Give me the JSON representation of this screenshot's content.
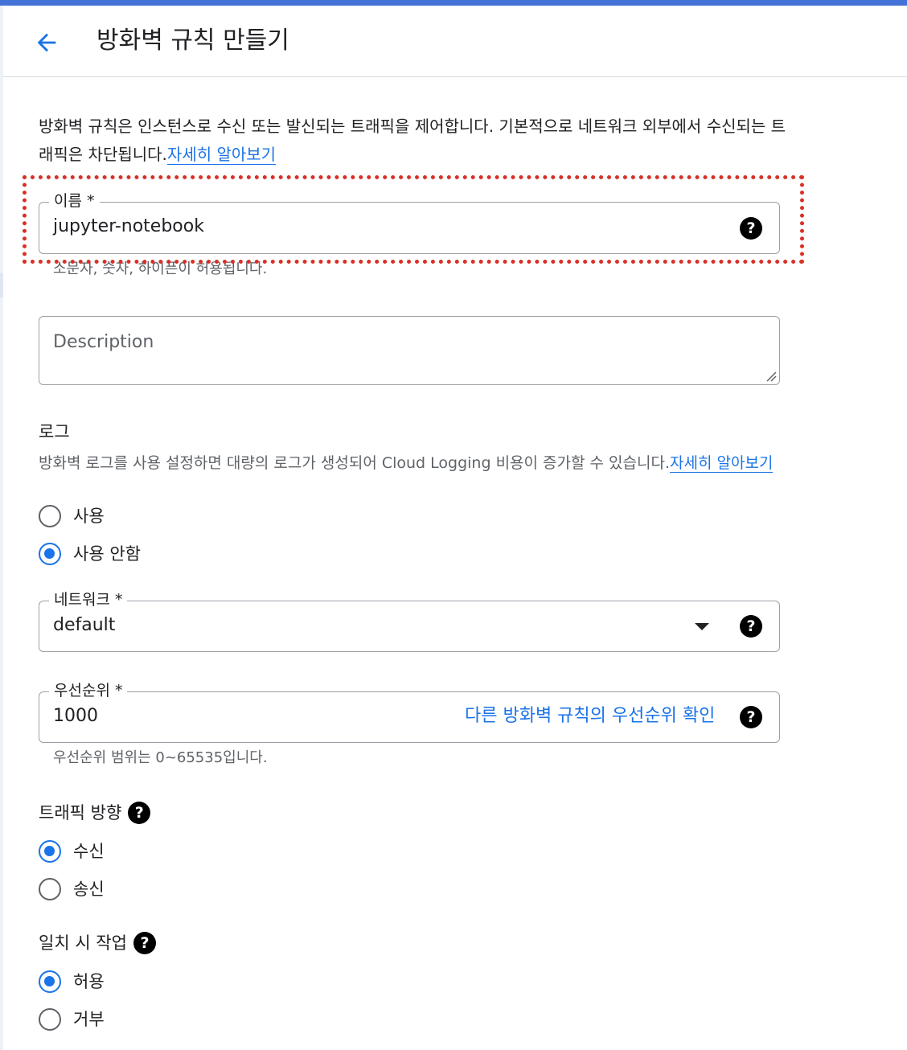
{
  "header": {
    "title": "방화벽 규칙 만들기",
    "back_icon": "arrow-back-icon"
  },
  "intro": {
    "text": "방화벽 규칙은 인스턴스로 수신 또는 발신되는 트래픽을 제어합니다. 기본적으로 네트워크 외부에서 수신되는 트래픽은 차단됩니다.",
    "link": "자세히 알아보기"
  },
  "name_field": {
    "label": "이름 *",
    "value": "jupyter-notebook",
    "hint": "소문자, 숫자, 하이픈이 허용됩니다."
  },
  "description_field": {
    "placeholder": "Description"
  },
  "logs": {
    "title": "로그",
    "description": "방화벽 로그를 사용 설정하면 대량의 로그가 생성되어 Cloud Logging 비용이 증가할 수 있습니다.",
    "link": "자세히 알아보기",
    "options": [
      "사용",
      "사용 안함"
    ],
    "selected": "사용 안함"
  },
  "network_field": {
    "label": "네트워크 *",
    "value": "default"
  },
  "priority_field": {
    "label": "우선순위 *",
    "value": "1000",
    "link": "다른 방화벽 규칙의 우선순위 확인",
    "hint": "우선순위 범위는 0~65535입니다."
  },
  "traffic_direction": {
    "title": "트래픽 방향",
    "options": [
      "수신",
      "송신"
    ],
    "selected": "수신"
  },
  "action_on_match": {
    "title": "일치 시 작업",
    "options": [
      "허용",
      "거부"
    ],
    "selected": "허용"
  },
  "colors": {
    "accent": "#1a73e8",
    "top_bar": "#4472d8",
    "highlight": "#d93025"
  }
}
